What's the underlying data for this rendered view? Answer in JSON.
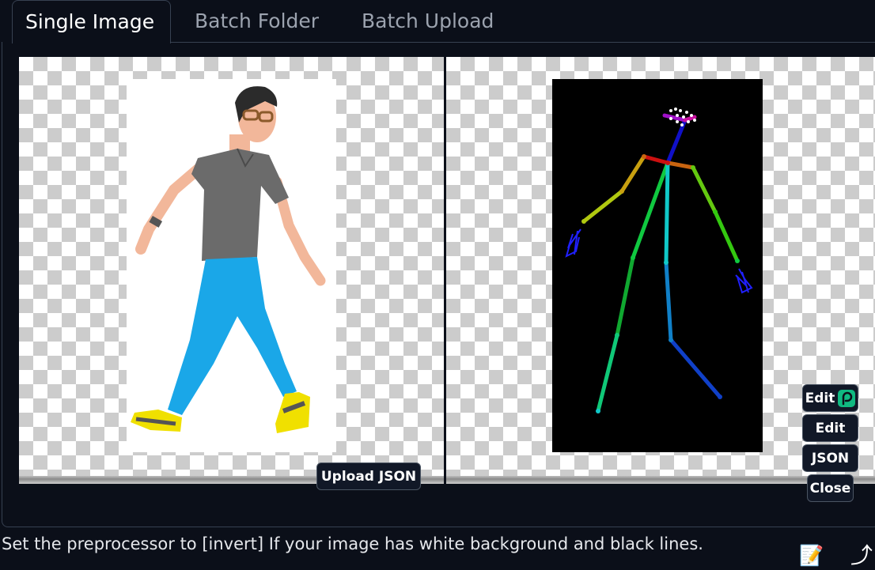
{
  "tabs": [
    {
      "label": "Single Image",
      "active": true
    },
    {
      "label": "Batch Folder",
      "active": false
    },
    {
      "label": "Batch Upload",
      "active": false
    }
  ],
  "buttons": {
    "upload_json": "Upload JSON",
    "edit_photopea": "Edit",
    "edit": "Edit",
    "json": "JSON",
    "close": "Close"
  },
  "hint_text": "Set the preprocessor to [invert] If your image has white background and black lines.",
  "icons": {
    "photopea": "photopea-logo-icon",
    "notes": "notepad-icon",
    "send": "curved-arrow-icon"
  },
  "colors": {
    "background": "#0b0f19",
    "border": "#374151",
    "button_bg": "#111827",
    "photopea_accent": "#10b981"
  }
}
